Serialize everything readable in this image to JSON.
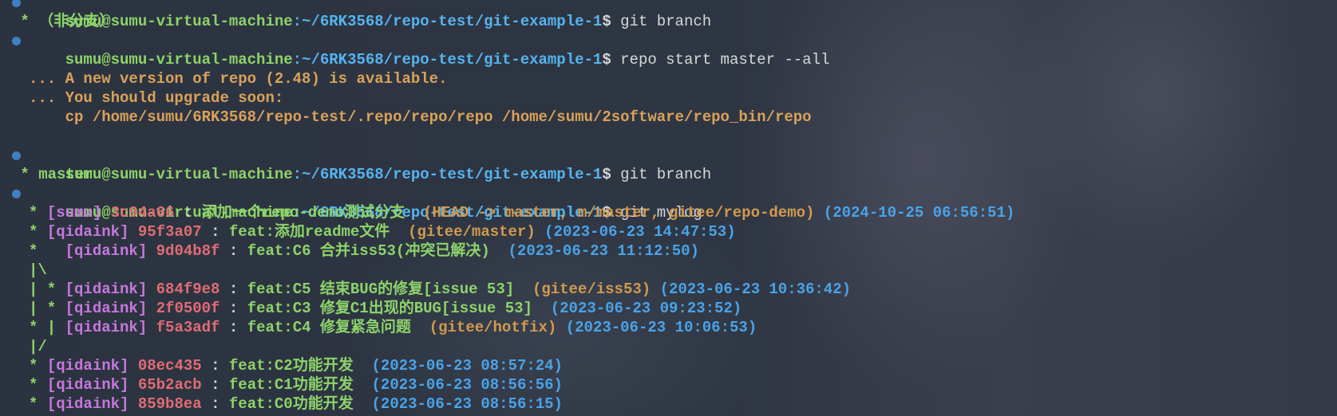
{
  "prompt": {
    "user": "sumu@sumu-virtual-machine",
    "path": ":~/6RK3568/repo-test/git-example-1",
    "sigil": "$ "
  },
  "lines": {
    "cmd1": "git branch",
    "branch_out1": " * （非分支）",
    "cmd2": "repo start master --all",
    "warn1": "... A new version of repo (2.48) is available.",
    "warn2": "... You should upgrade soon:",
    "warn3": "    cp /home/sumu/6RK3568/repo-test/.repo/repo/repo /home/sumu/2software/repo_bin/repo",
    "cmd3": "git branch",
    "branch_out2": " * master",
    "cmd4": "git mylog"
  },
  "log": [
    {
      "graph": "* ",
      "author": "[sumu]",
      "hash": "3c94a66",
      "sep": " : ",
      "msg": "添加一个repo-demo测试分支",
      "refs": "  (HEAD -> master, m/master, gitee/repo-demo)",
      "date": " (2024-10-25 06:56:51)"
    },
    {
      "graph": "* ",
      "author": "[qidaink]",
      "hash": "95f3a07",
      "sep": " : ",
      "msg": "feat:添加readme文件",
      "refs": "  (gitee/master)",
      "date": " (2023-06-23 14:47:53)"
    },
    {
      "graph": "*   ",
      "author": "[qidaink]",
      "hash": "9d04b8f",
      "sep": " : ",
      "msg": "feat:C6 合并iss53(冲突已解决)",
      "refs": "",
      "date": "  (2023-06-23 11:12:50)"
    },
    {
      "graph": "|\\",
      "author": "",
      "hash": "",
      "sep": "",
      "msg": "",
      "refs": "",
      "date": ""
    },
    {
      "graph": "| * ",
      "author": "[qidaink]",
      "hash": "684f9e8",
      "sep": " : ",
      "msg": "feat:C5 结束BUG的修复[issue 53]",
      "refs": "  (gitee/iss53)",
      "date": " (2023-06-23 10:36:42)"
    },
    {
      "graph": "| * ",
      "author": "[qidaink]",
      "hash": "2f0500f",
      "sep": " : ",
      "msg": "feat:C3 修复C1出现的BUG[issue 53]",
      "refs": "",
      "date": "  (2023-06-23 09:23:52)"
    },
    {
      "graph": "* | ",
      "author": "[qidaink]",
      "hash": "f5a3adf",
      "sep": " : ",
      "msg": "feat:C4 修复紧急问题",
      "refs": "  (gitee/hotfix)",
      "date": " (2023-06-23 10:06:53)"
    },
    {
      "graph": "|/",
      "author": "",
      "hash": "",
      "sep": "",
      "msg": "",
      "refs": "",
      "date": ""
    },
    {
      "graph": "* ",
      "author": "[qidaink]",
      "hash": "08ec435",
      "sep": " : ",
      "msg": "feat:C2功能开发",
      "refs": "",
      "date": "  (2023-06-23 08:57:24)"
    },
    {
      "graph": "* ",
      "author": "[qidaink]",
      "hash": "65b2acb",
      "sep": " : ",
      "msg": "feat:C1功能开发",
      "refs": "",
      "date": "  (2023-06-23 08:56:56)"
    },
    {
      "graph": "* ",
      "author": "[qidaink]",
      "hash": "859b8ea",
      "sep": " : ",
      "msg": "feat:C0功能开发",
      "refs": "",
      "date": "  (2023-06-23 08:56:15)"
    }
  ]
}
